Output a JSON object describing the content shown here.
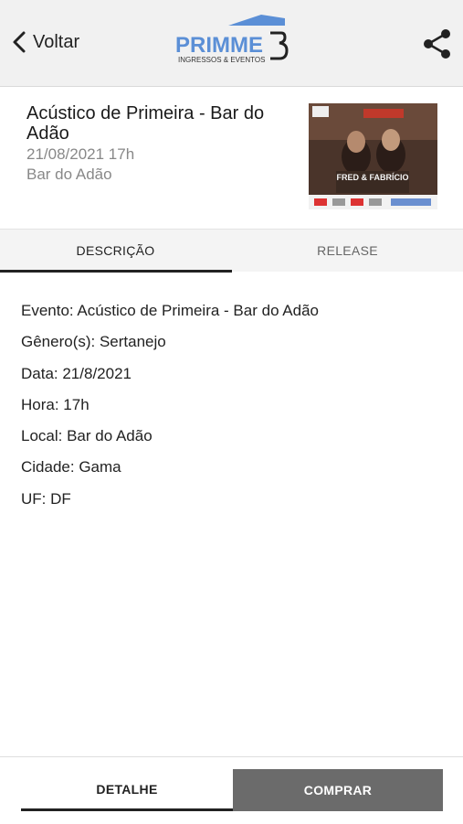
{
  "header": {
    "back_label": "Voltar",
    "logo_text": "PRIMME",
    "logo_subtitle": "INGRESSOS & EVENTOS"
  },
  "event": {
    "title": "Acústico de Primeira - Bar do Adão",
    "datetime": "21/08/2021 17h",
    "venue": "Bar do Adão"
  },
  "poster": {
    "title": "FRED & FABRÍCIO"
  },
  "tabs": [
    {
      "label": "DESCRIÇÃO",
      "active": true
    },
    {
      "label": "RELEASE",
      "active": false
    }
  ],
  "details": [
    "Evento: Acústico de Primeira - Bar do Adão",
    "Gênero(s): Sertanejo",
    "Data: 21/8/2021",
    "Hora: 17h",
    "Local: Bar do Adão",
    "Cidade: Gama",
    "UF: DF"
  ],
  "bottom": {
    "detail_label": "DETALHE",
    "buy_label": "COMPRAR"
  },
  "colors": {
    "brand_blue": "#5b8fd6",
    "dark": "#222222",
    "buy_bg": "#6b6b6b"
  }
}
